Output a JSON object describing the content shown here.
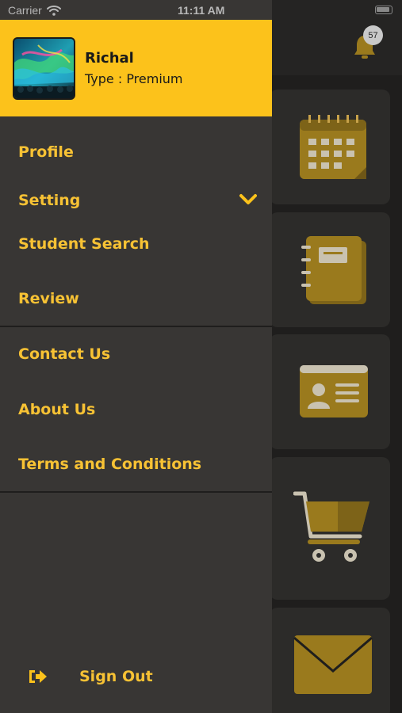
{
  "status_bar": {
    "carrier": "Carrier",
    "time": "11:11 AM"
  },
  "header": {
    "notification_count": "57"
  },
  "drawer": {
    "user": {
      "name": "Richal",
      "type": "Type : Premium"
    },
    "menu": [
      {
        "label": "Profile"
      },
      {
        "label": "Setting"
      },
      {
        "label": "Student Search"
      },
      {
        "label": "Review"
      },
      {
        "label": "Contact Us"
      },
      {
        "label": "About Us"
      },
      {
        "label": "Terms and Conditions"
      }
    ],
    "sign_out": "Sign Out"
  },
  "background_cards": [
    {
      "icon": "calendar-icon"
    },
    {
      "icon": "notebook-icon"
    },
    {
      "icon": "id-card-icon"
    },
    {
      "icon": "shopping-cart-icon"
    },
    {
      "icon": "envelope-icon"
    }
  ],
  "colors": {
    "accent": "#fcc21b",
    "drawer_bg": "#383634",
    "menu_text": "#f7c234",
    "dim_icon": "#9a7a1d"
  }
}
